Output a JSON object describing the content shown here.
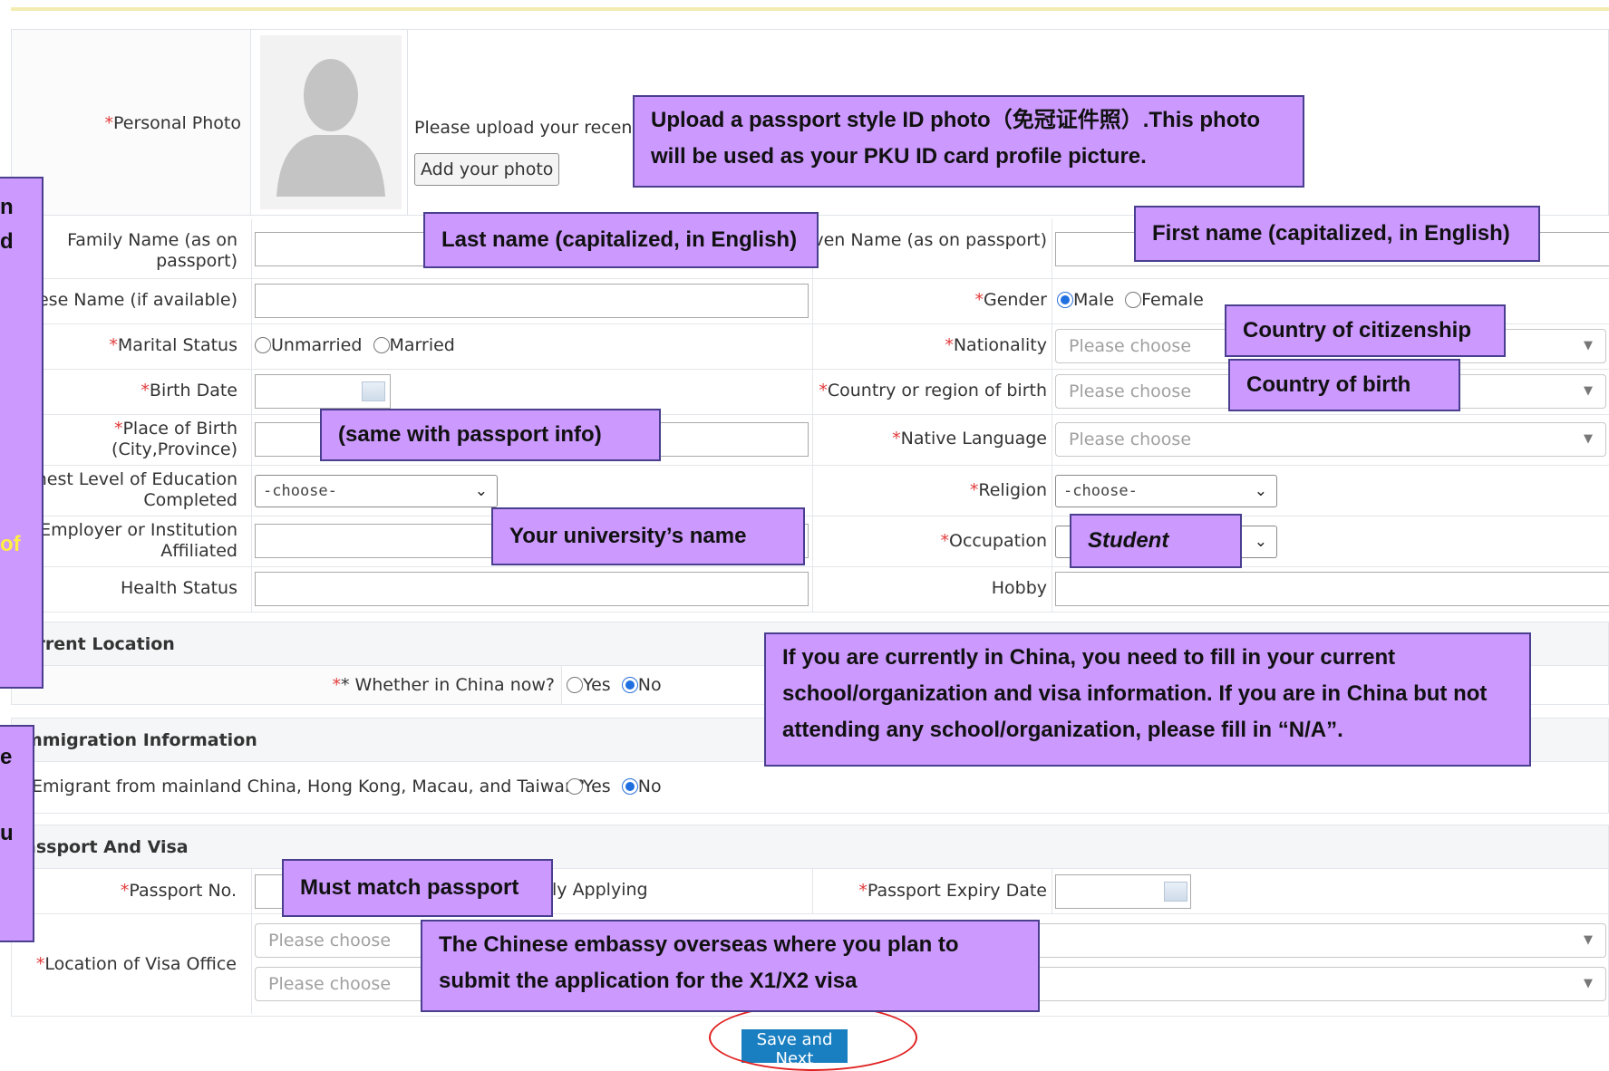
{
  "photo": {
    "label": "Personal Photo",
    "upload_text": "Please upload your recent full faced passport size photo (*.jpg,*.jpeg)",
    "add_button": "Add your photo"
  },
  "fields": {
    "family_name": "Family Name (as on passport)",
    "given_name": "Given Name (as on passport)",
    "chinese_name": "inese Name (if available)",
    "gender": "Gender",
    "gender_male": "Male",
    "gender_female": "Female",
    "marital_status": "Marital Status",
    "unmarried": "Unmarried",
    "married": "Married",
    "nationality": "Nationality",
    "birth_date": "Birth Date",
    "country_of_birth": "Country or region of birth",
    "place_of_birth": "Place of Birth (City,Province)",
    "native_language": "Native Language",
    "education": "ighest Level of Education Completed",
    "religion": "Religion",
    "employer": "Employer or Institution Affiliated",
    "occupation": "Occupation",
    "health_status": "Health Status",
    "hobby": "Hobby",
    "please_choose": "Please choose",
    "choose": "-choose-"
  },
  "current_location": {
    "title": "urrent Location",
    "question": "* Whether in China now?",
    "yes": "Yes",
    "no": "No"
  },
  "immigration": {
    "title": "mmigration Information",
    "question": "Emigrant from mainland China, Hong Kong, Macau, and Taiwan?",
    "yes": "Yes",
    "no": "No"
  },
  "passport": {
    "title": "assport And Visa",
    "passport_no": "Passport No.",
    "applying_text": "ly Applying",
    "expiry_date": "Passport Expiry Date",
    "visa_office": "Location of Visa Office",
    "please_choose": "Please choose"
  },
  "save_button": "Save and Next",
  "callouts": {
    "photo_line1": "Upload a passport style ID photo（免冠证件照）.This photo",
    "photo_line2": "will be used as your PKU ID card profile picture.",
    "last_name": "Last name (capitalized, in English)",
    "first_name": "First name (capitalized, in English)",
    "citizenship": "Country of citizenship",
    "birth_country": "Country of birth",
    "same_passport": "(same with passport info)",
    "university": "Your university’s name",
    "student": "Student",
    "china_line1": "If you are currently in China, you need to fill in your current",
    "china_line2": "school/organization and visa information. If you are in China but not",
    "china_line3": "attending any school/organization, please fill in “N/A”.",
    "must_match": "Must match passport",
    "embassy_line1": "The Chinese embassy overseas where you plan to",
    "embassy_line2": "submit the application for the X1/X2 visa"
  },
  "side_fragments": [
    "n",
    "d",
    "of",
    "e",
    "u"
  ],
  "colors": {
    "callout_fill": "#cc99ff",
    "callout_border": "#4a3f8f",
    "required_star": "#e23b3b",
    "save_button": "#1a7fc1",
    "radio_checked": "#1f6fe0",
    "side_fragment_highlight": "#ffee44"
  }
}
